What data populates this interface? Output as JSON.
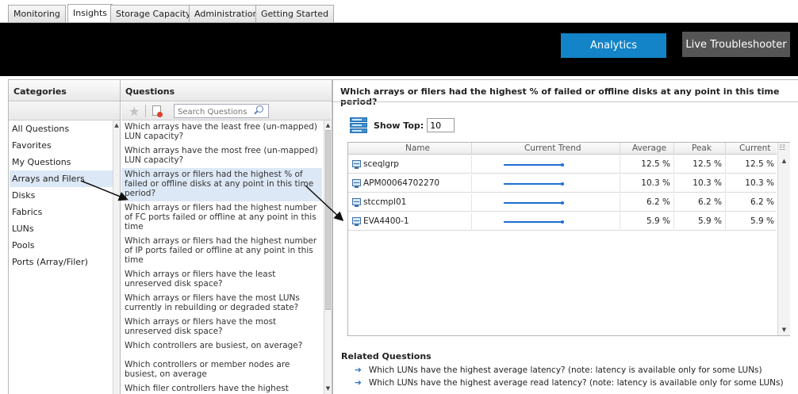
{
  "tabs": [
    {
      "label": "Monitoring",
      "active": false
    },
    {
      "label": "Insights",
      "active": true
    },
    {
      "label": "Storage Capacity",
      "active": false
    },
    {
      "label": "Administration",
      "active": false
    },
    {
      "label": "Getting Started",
      "active": false
    }
  ],
  "header": {
    "analytics_label": "Analytics",
    "live_label": "Live Troubleshooter"
  },
  "colors": {
    "analytics_button": "#1484c8",
    "live_button": "#555555",
    "header_bg": "#000000",
    "selection_bg": "#dde8f6",
    "trend_line": "#1e6fd0"
  },
  "categories": {
    "header": "Categories",
    "items": [
      {
        "label": "All Questions",
        "selected": false
      },
      {
        "label": "Favorites",
        "selected": false
      },
      {
        "label": "My Questions",
        "selected": false
      },
      {
        "label": "Arrays and Filers",
        "selected": true
      },
      {
        "label": "Disks",
        "selected": false
      },
      {
        "label": "Fabrics",
        "selected": false
      },
      {
        "label": "LUNs",
        "selected": false
      },
      {
        "label": "Pools",
        "selected": false
      },
      {
        "label": "Ports (Array/Filer)",
        "selected": false
      }
    ]
  },
  "questions": {
    "header": "Questions",
    "search_placeholder": "Search Questions",
    "toolbar_icons": [
      "star-icon",
      "new-question-icon",
      "search-icon"
    ],
    "items": [
      {
        "text": "Which arrays have the least free (un-mapped) LUN capacity?",
        "selected": false
      },
      {
        "text": "Which arrays have the most free (un-mapped) LUN capacity?",
        "selected": false
      },
      {
        "text": "Which arrays or filers had the highest % of failed or offline disks at any point in this time period?",
        "selected": true
      },
      {
        "text": "Which arrays or filers had the highest number of FC ports failed or offline at any point in this time",
        "selected": false
      },
      {
        "text": "Which arrays or filers had the highest number of IP ports failed or offline at any point in this time",
        "selected": false
      },
      {
        "text": "Which arrays or filers have the least unreserved disk space?",
        "selected": false
      },
      {
        "text": "Which arrays or filers have the most LUNs currently in rebuilding or degraded state?",
        "selected": false
      },
      {
        "text": "Which arrays or filers have the most unreserved disk space?",
        "selected": false
      },
      {
        "text": "Which controllers are busiest, on average?",
        "selected": false
      },
      {
        "text": "Which controllers or member nodes are busiest, on average",
        "selected": false
      },
      {
        "text": "Which filer controllers have the highest average",
        "selected": false
      }
    ]
  },
  "main": {
    "title": "Which arrays or filers had the highest % of failed or offline disks at any point in this time period?",
    "show_top_label": "Show Top:",
    "show_top_value": "10",
    "table": {
      "columns": [
        "Name",
        "Current Trend",
        "Average",
        "Peak",
        "Current"
      ],
      "rows": [
        {
          "name": "sceqlgrp",
          "average": "12.5 %",
          "peak": "12.5 %",
          "current": "12.5 %"
        },
        {
          "name": "APM00064702270",
          "average": "10.3 %",
          "peak": "10.3 %",
          "current": "10.3 %"
        },
        {
          "name": "stccmpl01",
          "average": "6.2 %",
          "peak": "6.2 %",
          "current": "6.2 %"
        },
        {
          "name": "EVA4400-1",
          "average": "5.9 %",
          "peak": "5.9 %",
          "current": "5.9 %"
        }
      ]
    },
    "related": {
      "title": "Related Questions",
      "items": [
        "Which LUNs have the highest average latency? (note: latency is available only for some LUNs)",
        "Which LUNs have the highest average read latency? (note: latency is available only for some LUNs)"
      ]
    }
  }
}
